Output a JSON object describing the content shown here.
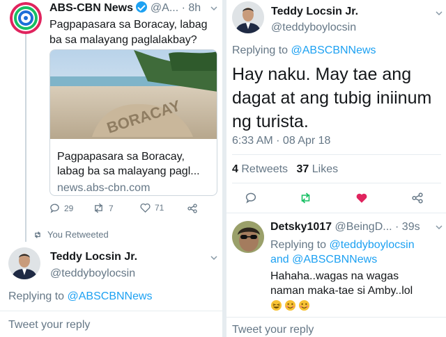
{
  "left": {
    "retweeted_tweet": {
      "name": "ABS-CBN News",
      "handle_time": "@A... · 8h",
      "text_line1": "Pagpapasara sa Boracay, labag",
      "text_line2": "ba sa malayang paglalakbay?",
      "card": {
        "title_line1": "Pagpapasara sa Boracay,",
        "title_line2": "labag ba sa malayang pagl...",
        "domain": "news.abs-cbn.com",
        "image_text": "BORACAY"
      },
      "actions": {
        "replies": "29",
        "retweets": "7",
        "likes": "71"
      }
    },
    "retweet_indicator": "You Retweeted",
    "reply_author": {
      "name": "Teddy Locsin Jr.",
      "handle": "@teddyboylocsin"
    },
    "replying_to": {
      "prefix": "Replying to ",
      "mention": "@ABSCBNNews"
    },
    "reply_placeholder": "Tweet your reply"
  },
  "right": {
    "author": {
      "name": "Teddy Locsin Jr.",
      "handle": "@teddyboylocsin"
    },
    "replying_to": {
      "prefix": "Replying to ",
      "mention": "@ABSCBNNews"
    },
    "tweet_line1": "Hay naku. May tae ang",
    "tweet_line2": "dagat at ang tubig iniinum",
    "tweet_line3": "ng turista.",
    "timestamp": "6:33 AM · 08 Apr 18",
    "stats": {
      "retweets_count": "4",
      "retweets_label": "Retweets",
      "likes_count": "37",
      "likes_label": "Likes"
    },
    "reply": {
      "name": "Detsky1017",
      "handle_time": "@BeingD... · 39s",
      "replying_prefix": "Replying to ",
      "mention1": "@teddyboylocsin",
      "and": "and ",
      "mention2": "@ABSCBNNews",
      "text_line1": "Hahaha..wagas na wagas",
      "text_line2": "naman maka-tae si Amby..lol"
    },
    "reply_placeholder": "Tweet your reply"
  },
  "colors": {
    "blue": "#1da1f2",
    "muted": "#657786",
    "retweet_green": "#17bf63",
    "like_red": "#e0245e"
  }
}
